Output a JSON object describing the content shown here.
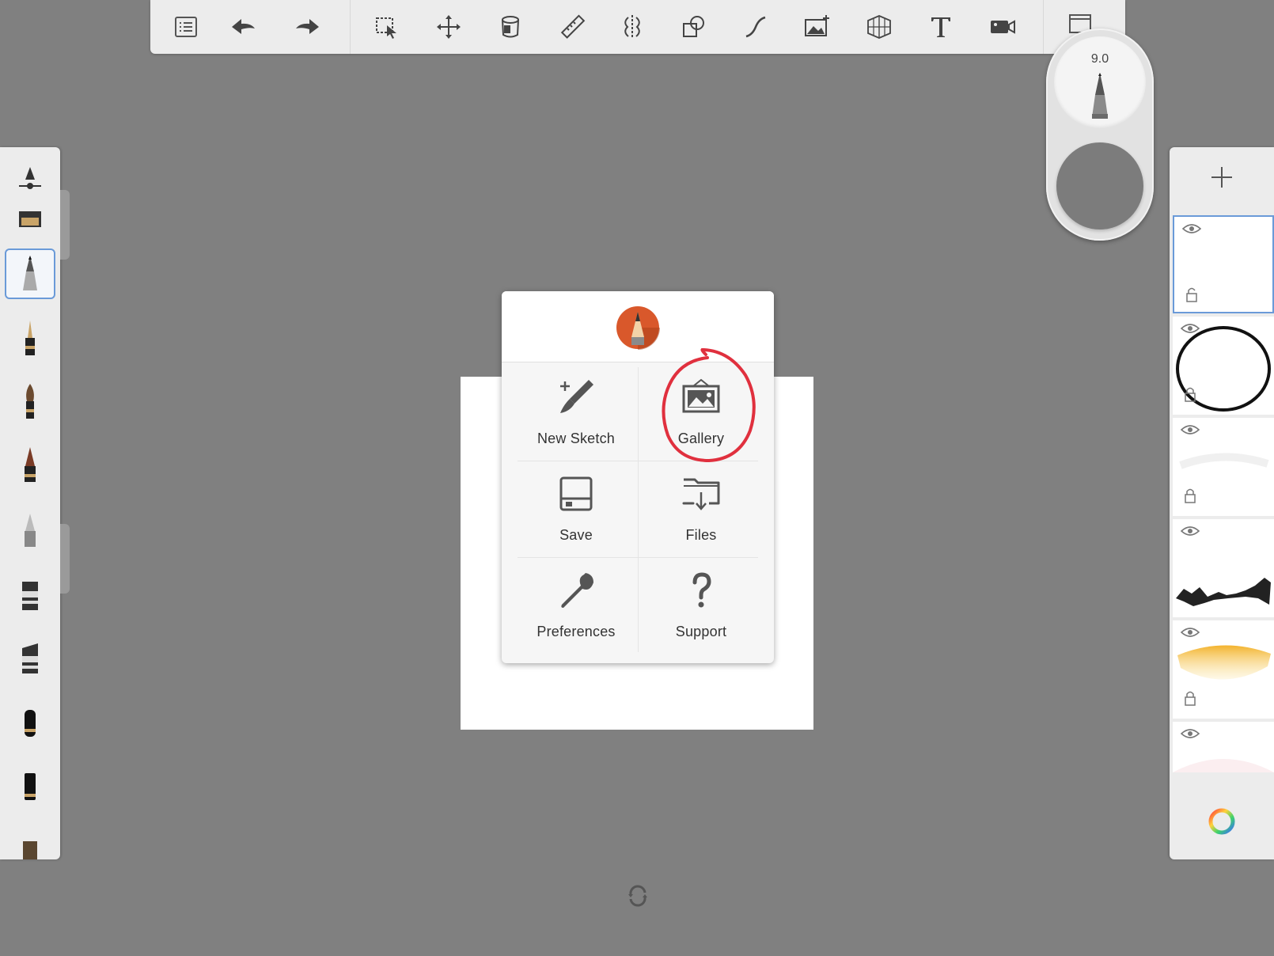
{
  "toolbar": {
    "items": [
      {
        "name": "lagoon-menu",
        "icon": "list-icon"
      },
      {
        "name": "undo",
        "icon": "undo-arrow-icon"
      },
      {
        "name": "redo",
        "icon": "redo-arrow-icon"
      },
      {
        "name": "selection",
        "icon": "selection-icon"
      },
      {
        "name": "transform",
        "icon": "move-icon"
      },
      {
        "name": "fill",
        "icon": "paint-bucket-icon"
      },
      {
        "name": "ruler",
        "icon": "ruler-icon"
      },
      {
        "name": "symmetry",
        "icon": "symmetry-icon"
      },
      {
        "name": "shapes",
        "icon": "shapes-icon"
      },
      {
        "name": "stroke",
        "icon": "curve-icon"
      },
      {
        "name": "import-image",
        "icon": "add-image-icon"
      },
      {
        "name": "perspective",
        "icon": "perspective-grid-icon"
      },
      {
        "name": "text",
        "icon": "text-icon"
      },
      {
        "name": "record",
        "icon": "video-camera-icon"
      },
      {
        "name": "view",
        "icon": "window-icon"
      }
    ]
  },
  "brush_puck": {
    "size_value": "9.0",
    "opacity_color": "#7c7c7c"
  },
  "brush_palette": {
    "selected_index": 2,
    "items": [
      "pencil-adjust-icon",
      "marker-icon",
      "pencil-icon",
      "ballpoint-pen-icon",
      "paintbrush-icon",
      "ink-pen-icon",
      "airbrush-icon",
      "chisel-marker-icon",
      "wide-marker-icon",
      "felt-tip-icon",
      "paint-tube-icon",
      "smudge-icon"
    ]
  },
  "layers": {
    "add_icon": "plus-icon",
    "color_icon": "color-wheel-icon",
    "items": [
      {
        "thumb": "blank",
        "active": true
      },
      {
        "thumb": "circle-sketch",
        "active": false
      },
      {
        "thumb": "faint-stroke",
        "active": false
      },
      {
        "thumb": "ink-strokes",
        "active": false
      },
      {
        "thumb": "yellow-wash",
        "active": false
      },
      {
        "thumb": "pink-tint",
        "active": false
      }
    ]
  },
  "menu": {
    "logo_color": "#d9582b",
    "items": [
      {
        "label": "New Sketch",
        "icon": "new-sketch-icon"
      },
      {
        "label": "Gallery",
        "icon": "gallery-icon"
      },
      {
        "label": "Save",
        "icon": "save-icon"
      },
      {
        "label": "Files",
        "icon": "files-icon"
      },
      {
        "label": "Preferences",
        "icon": "wrench-icon"
      },
      {
        "label": "Support",
        "icon": "question-icon"
      }
    ],
    "highlight": {
      "target": "Gallery",
      "color": "#e0303e"
    }
  },
  "bottom": {
    "icon": "rotate-icon"
  }
}
